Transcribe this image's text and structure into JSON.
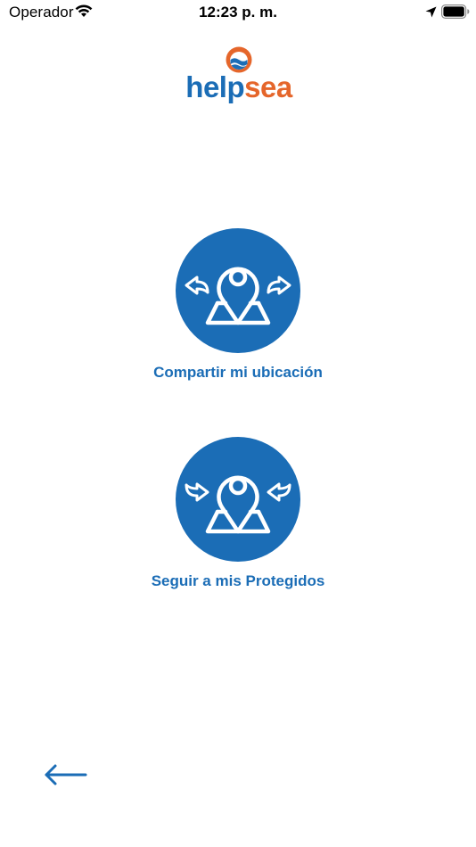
{
  "status_bar": {
    "carrier": "Operador",
    "time": "12:23 p. m."
  },
  "logo": {
    "part1": "help",
    "part2": "sea"
  },
  "actions": {
    "share_location_label": "Compartir mi ubicación",
    "follow_protected_label": "Seguir a mis Protegidos"
  },
  "colors": {
    "brand_blue": "#1b6db6",
    "brand_orange": "#e5662b"
  },
  "icons": {
    "share": "map-pin-outward-arrows-icon",
    "follow": "map-pin-inward-arrows-icon",
    "back": "arrow-left-icon"
  }
}
